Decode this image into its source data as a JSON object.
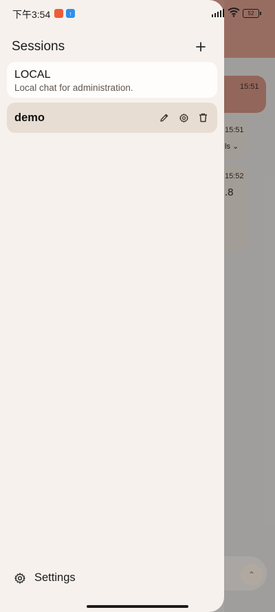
{
  "status_bar": {
    "time": "下午3:54",
    "battery": "52"
  },
  "drawer": {
    "title": "Sessions",
    "add_icon": "plus-icon",
    "sessions": [
      {
        "name": "LOCAL",
        "description": "Local chat for administration."
      },
      {
        "name": "demo",
        "actions": [
          "edit-icon",
          "gear-icon",
          "trash-icon"
        ]
      }
    ],
    "settings_label": "Settings"
  },
  "background_chat": {
    "times": [
      "15:51",
      "15:51",
      "15:52"
    ],
    "snippet_details": "ls",
    "snippet_value": ".8"
  },
  "colors": {
    "drawer_bg": "#f6f1ec",
    "selected_session_bg": "#e7ddd2",
    "header_dimmed": "#9d7165"
  }
}
